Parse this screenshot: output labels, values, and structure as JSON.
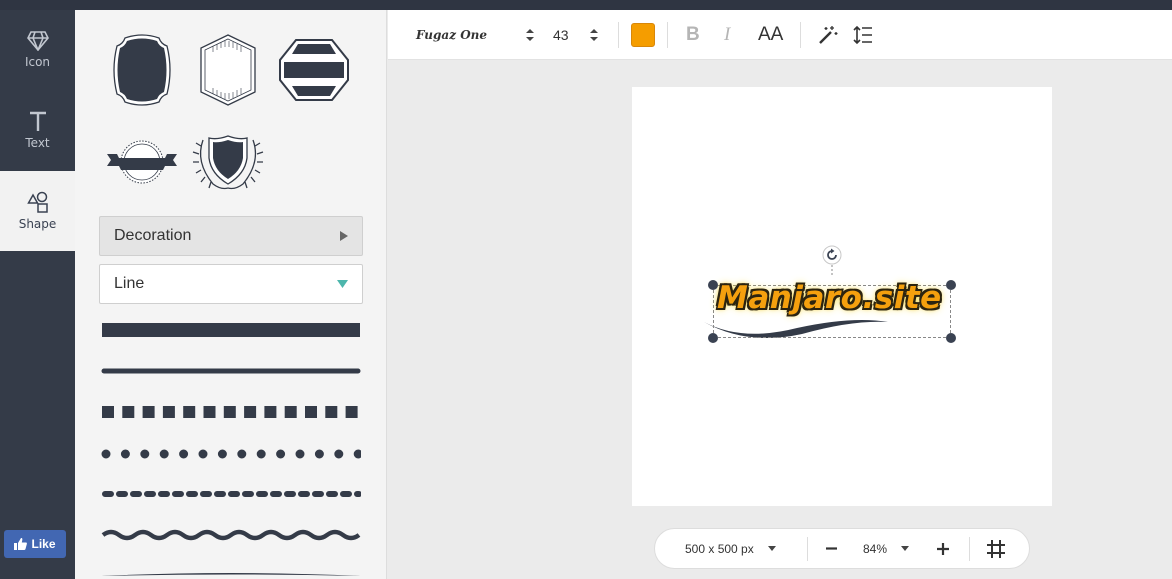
{
  "rail": {
    "items": [
      {
        "label": "Icon",
        "icon": "diamond-icon"
      },
      {
        "label": "Text",
        "icon": "text-t-icon"
      },
      {
        "label": "Shape",
        "icon": "shapes-icon"
      }
    ],
    "like_label": "Like"
  },
  "panel": {
    "decoration_label": "Decoration",
    "line_label": "Line"
  },
  "toolbar": {
    "font_name": "Fugaz One",
    "font_size": "43",
    "text_color": "#f59d00",
    "bold_label": "B",
    "italic_label": "I",
    "case_label": "AA"
  },
  "canvas": {
    "text": "Manjaro.site"
  },
  "bottom": {
    "canvas_size": "500 x 500 px",
    "zoom": "84%"
  },
  "colors": {
    "dark": "#343b48",
    "accent": "#f59d00",
    "dropdown_caret": "#4db6ac"
  }
}
